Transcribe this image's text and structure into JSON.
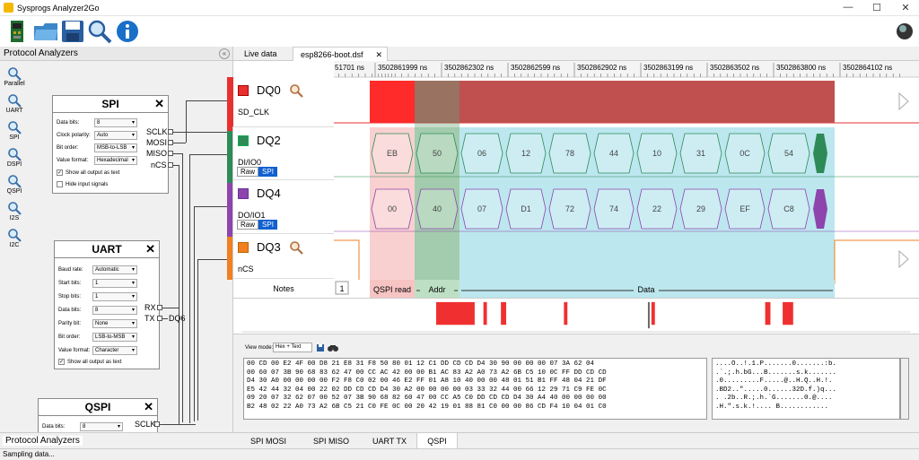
{
  "window": {
    "title": "Sysprogs Analyzer2Go",
    "minimize": "—",
    "maximize": "☐",
    "close": "✕"
  },
  "left_panel": {
    "header": "Protocol Analyzers",
    "tools": [
      "Parallel",
      "UART",
      "SPI",
      "DSPI",
      "QSPI",
      "I2S",
      "I2C"
    ],
    "tab": "Protocol Analyzers"
  },
  "spi": {
    "title": "SPI",
    "close": "✕",
    "data_bits_label": "Data bits:",
    "data_bits": "8",
    "clock_polarity_label": "Clock polarity:",
    "clock_polarity": "Auto",
    "bit_order_label": "Bit order:",
    "bit_order": "MSB-to-LSB",
    "value_format_label": "Value format:",
    "value_format": "Hexadecimal",
    "show_all_label": "Show all output as text",
    "hide_input_label": "Hide input signals",
    "pins": [
      "SCLK",
      "MOSI",
      "MISO",
      "nCS"
    ]
  },
  "uart": {
    "title": "UART",
    "close": "✕",
    "baud_label": "Baud rate:",
    "baud": "Automatic",
    "start_label": "Start bits:",
    "start": "1",
    "stop_label": "Stop bits:",
    "stop": "1",
    "data_label": "Data bits:",
    "data": "8",
    "parity_label": "Parity bit:",
    "parity": "None",
    "bit_order_label": "Bit order:",
    "bit_order": "LSB-to-MSB",
    "value_format_label": "Value format:",
    "value_format": "Character",
    "show_all_label": "Show all output as text",
    "pins": [
      "RX",
      "TX"
    ],
    "tx_wire_label": "DQ6"
  },
  "qspi": {
    "title": "QSPI",
    "close": "✕",
    "data_bits_label": "Data bits:",
    "data_bits": "8",
    "pins": [
      "SCLK"
    ]
  },
  "tabs": [
    "Live data",
    "esp8266-boot.dsf"
  ],
  "tab_close": "✕",
  "time_ticks": [
    "51701 ns",
    "3502861999 ns",
    "3502862302 ns",
    "3502862599 ns",
    "3502862902 ns",
    "3502863199 ns",
    "3502863502 ns",
    "3502863800 ns",
    "3502864102 ns"
  ],
  "channels": [
    {
      "name": "DQ0",
      "sub": "SD_CLK",
      "color": "#e83030"
    },
    {
      "name": "DQ2",
      "sub": "DI/IO0",
      "color": "#2e8b57",
      "raw": "Raw",
      "spi": "SPI"
    },
    {
      "name": "DQ4",
      "sub": "DO/IO1",
      "color": "#8e44ad",
      "raw": "Raw",
      "spi": "SPI"
    },
    {
      "name": "DQ3",
      "sub": "nCS",
      "color": "#f08020"
    }
  ],
  "dq2_bytes": [
    "EB",
    "50",
    "06",
    "12",
    "78",
    "44",
    "10",
    "31",
    "0C",
    "54"
  ],
  "dq4_bytes": [
    "00",
    "40",
    "07",
    "D1",
    "72",
    "74",
    "22",
    "29",
    "EF",
    "C8"
  ],
  "notes": {
    "label": "Notes",
    "count": "1",
    "qspi_read": "QSPI read",
    "addr": "Addr",
    "data": "Data"
  },
  "hex_view": {
    "view_mode_label": "View mode:",
    "view_mode": "Hex + Text",
    "hex_lines": [
      "00 CD 00 E2 4F 00 D8 21 E8 31 F8 50 80 01 12 C1 DD CD CD D4 30 90 00 00 00 07 3A 62 04",
      "00 60 07 3B 90 68 83 62 47 00 CC AC 42 00 00 B1 AC 83 A2 A0 73 A2 6B C5 10 0C FF DD CD CD",
      "D4 30 A0 00 00 00 00 F2 F8 C0 02 00 46 E2 FF 01 A8 10 40 00 00 48 01 51 B1 FF 48 04 21 DF",
      "E5 42 44 32 04 00 22 02 DD CD CD D4 30 A2 00 00 00 00 03 33 32 44 00 66 12 29 71 C9 FE 0C",
      "09 20 07 32 62 07 00 52 07 3B 90 68 82 60 47 00 CC A5 C0 DD CD CD D4 30 A4 40 00 00 00 00",
      "B2 48 02 22 A0 73 A2 6B C5 21 C0 FE 0C 00 20 42 19 01 88 81 C0 00 00 86 CD F4 10 04 01 C0"
    ],
    "ascii_lines": [
      "....O..!.1.P.......0.......:b.",
      ".`.;.h.bG...B.......s.k.......",
      ".0.........F.....@..H.Q..H.!.",
      ".BD2..\".....0......32D.f.)q...",
      ". .2b..R.;.h.`G.......0.@....",
      ".H.\".s.k.!.... B............"
    ]
  },
  "bottom_tabs": [
    "SPI MOSI",
    "SPI MISO",
    "UART TX",
    "QSPI"
  ],
  "status": "Sampling data...",
  "colors": {
    "red": "#e83030",
    "green": "#2e8b57",
    "purple": "#8e44ad",
    "orange": "#f08020",
    "data_cyan": "#8fd8e6",
    "spi_blue": "#1060d0"
  }
}
